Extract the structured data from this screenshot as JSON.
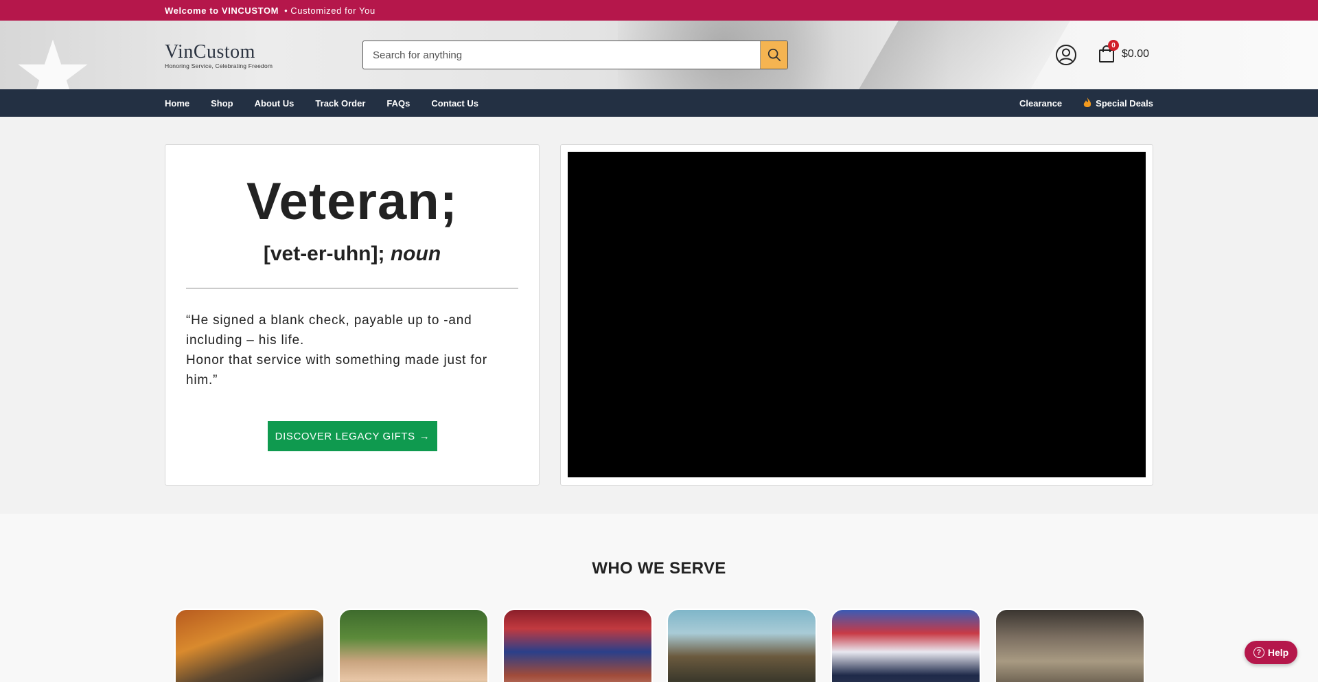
{
  "announcement": {
    "brand": "Welcome to VINCUSTOM",
    "separator": "•",
    "tagline": "Customized for You"
  },
  "header": {
    "logo_name": "VinCustom",
    "logo_tagline": "Honoring Service, Celebrating Freedom",
    "search_placeholder": "Search for anything",
    "cart_count": "0",
    "cart_total": "$0.00",
    "accent_color": "#b5174b",
    "search_button_color": "#f5b451"
  },
  "nav": {
    "items": [
      "Home",
      "Shop",
      "About Us",
      "Track Order",
      "FAQs",
      "Contact Us"
    ],
    "right_items": [
      "Clearance",
      "Special Deals"
    ]
  },
  "hero": {
    "word": "Veteran;",
    "pronunciation": "[vet-er-uhn];",
    "part_of_speech": "noun",
    "quote_line1": "“He signed a blank check, payable up to -and including – his life.",
    "quote_line2": "Honor that service with something made just for him.”",
    "cta_label": "DISCOVER LEGACY GIFTS",
    "cta_arrow": "→",
    "cta_color": "#0f9a4f"
  },
  "serve": {
    "title": "WHO WE SERVE",
    "tiles": [
      "tile-1",
      "tile-2",
      "tile-3",
      "tile-4",
      "tile-5",
      "tile-6"
    ]
  },
  "help": {
    "label": "Help"
  }
}
